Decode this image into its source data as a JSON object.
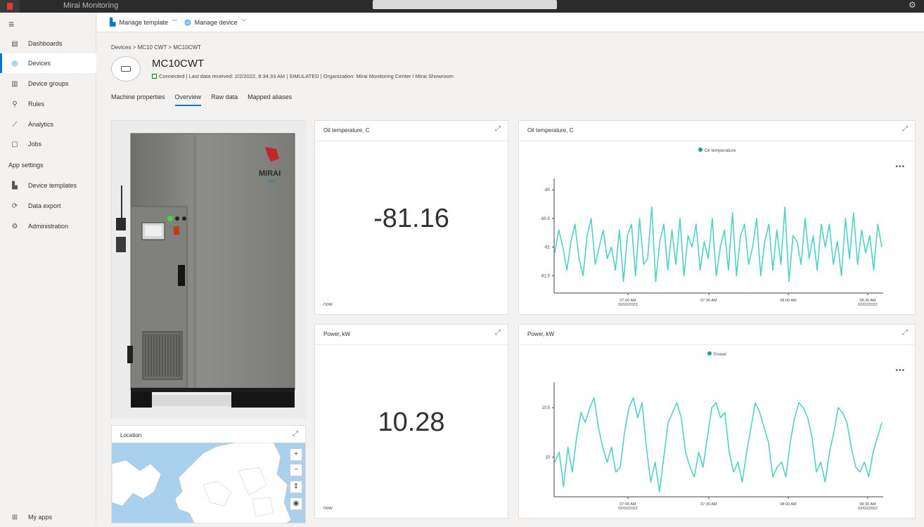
{
  "topbar": {
    "app_name": "Mirai Monitoring"
  },
  "sidebar": {
    "items": [
      {
        "label": "Dashboards",
        "icon": "dashboard-icon"
      },
      {
        "label": "Devices",
        "icon": "devices-icon",
        "active": true
      },
      {
        "label": "Device groups",
        "icon": "device-groups-icon"
      },
      {
        "label": "Rules",
        "icon": "rules-icon"
      },
      {
        "label": "Analytics",
        "icon": "analytics-icon"
      },
      {
        "label": "Jobs",
        "icon": "jobs-icon"
      }
    ],
    "section_label": "App settings",
    "settings_items": [
      {
        "label": "Device templates",
        "icon": "device-templates-icon"
      },
      {
        "label": "Data export",
        "icon": "data-export-icon"
      },
      {
        "label": "Administration",
        "icon": "administration-icon"
      }
    ],
    "bottom_item": {
      "label": "My apps",
      "icon": "my-apps-icon"
    }
  },
  "commandbar": {
    "manage_template": "Manage template",
    "manage_device": "Manage device"
  },
  "breadcrumb": "Devices > MC10 CWT > MC10CWT",
  "device": {
    "title": "MC10CWT",
    "status": "Connected | Last data received: 2/2/2022, 8:34:33 AM | SIMULATED | Organization: Mirai Monitoring Center / Mirai Showroom"
  },
  "tabs": [
    "Machine properties",
    "Overview",
    "Raw data",
    "Mapped aliases"
  ],
  "active_tab": "Overview",
  "tiles": {
    "oil_kpi": {
      "title": "Oil temperature, C",
      "value": "-81.16",
      "footer": "now"
    },
    "power_kpi": {
      "title": "Power, kW",
      "value": "10.28",
      "footer": "now"
    },
    "oil_chart_title": "Oil temperature, C",
    "power_chart_title": "Power, kW",
    "location_title": "Location"
  },
  "machine_image": {
    "brand": "MIRAI",
    "model": "CWT"
  },
  "colors": {
    "accent": "#0078d4",
    "series": "#4fd1c5",
    "legend_dot": "#1a9e9a"
  },
  "chart_data": [
    {
      "type": "line",
      "series": [
        {
          "name": "Oil temperature",
          "values": [
            -81.1,
            -80.7,
            -81.0,
            -81.4,
            -80.9,
            -80.6,
            -81.2,
            -81.5,
            -80.8,
            -80.5,
            -81.3,
            -81.0,
            -80.7,
            -81.2,
            -81.0,
            -81.4,
            -80.7,
            -81.6,
            -80.8,
            -80.6,
            -81.5,
            -80.5,
            -81.3,
            -81.2,
            -80.3,
            -81.6,
            -80.9,
            -80.6,
            -81.4,
            -80.7,
            -81.3,
            -80.5,
            -81.5,
            -80.8,
            -81.0,
            -80.6,
            -81.4,
            -80.9,
            -81.2,
            -80.5,
            -81.5,
            -81.0,
            -80.7,
            -81.4,
            -80.4,
            -81.5,
            -80.8,
            -80.6,
            -81.3,
            -81.0,
            -80.5,
            -81.5,
            -80.9,
            -80.6,
            -81.4,
            -80.7,
            -81.3,
            -80.3,
            -81.6,
            -80.8,
            -80.9,
            -81.3,
            -80.5,
            -81.2,
            -80.8,
            -81.4,
            -80.6,
            -81.0,
            -80.6,
            -81.3,
            -80.9,
            -81.5,
            -80.5,
            -81.2,
            -80.4,
            -81.3,
            -80.7,
            -81.1,
            -80.8,
            -81.4,
            -80.6,
            -81.0
          ]
        }
      ],
      "x_ticks": [
        {
          "label": "07:00 AM",
          "sublabel": "02/02/2022"
        },
        {
          "label": "07:30 AM",
          "sublabel": ""
        },
        {
          "label": "08:00 AM",
          "sublabel": ""
        },
        {
          "label": "08:30 AM",
          "sublabel": "02/02/2022"
        }
      ],
      "y_ticks": [
        -80,
        -80.5,
        -81,
        -81.5
      ],
      "ylim": [
        -81.8,
        -79.9
      ]
    },
    {
      "type": "line",
      "series": [
        {
          "name": "Power",
          "values": [
            9.95,
            10.05,
            9.7,
            10.1,
            9.85,
            10.2,
            10.45,
            10.35,
            10.5,
            10.6,
            10.3,
            10.1,
            9.95,
            10.1,
            9.85,
            9.9,
            10.25,
            10.5,
            10.6,
            10.4,
            10.55,
            10.1,
            9.75,
            9.95,
            9.65,
            10.0,
            10.35,
            10.45,
            10.55,
            10.4,
            10.05,
            9.9,
            9.8,
            10.05,
            9.9,
            10.2,
            10.5,
            10.55,
            10.4,
            10.45,
            10.05,
            9.85,
            9.95,
            9.75,
            10.05,
            10.3,
            10.55,
            10.45,
            10.3,
            10.15,
            9.8,
            9.9,
            9.95,
            9.8,
            10.15,
            10.4,
            10.55,
            10.5,
            10.4,
            10.2,
            9.85,
            9.95,
            9.75,
            10.05,
            10.25,
            10.5,
            10.45,
            10.35,
            10.1,
            9.9,
            9.85,
            9.95,
            9.8,
            10.05,
            10.2,
            10.35
          ]
        }
      ],
      "x_ticks": [
        {
          "label": "07:00 AM",
          "sublabel": "02/02/2022"
        },
        {
          "label": "07:30 AM",
          "sublabel": ""
        },
        {
          "label": "08:00 AM",
          "sublabel": ""
        },
        {
          "label": "08:30 AM",
          "sublabel": "02/02/2022"
        }
      ],
      "y_ticks": [
        10.5,
        10
      ],
      "ylim": [
        9.6,
        10.7
      ]
    }
  ]
}
